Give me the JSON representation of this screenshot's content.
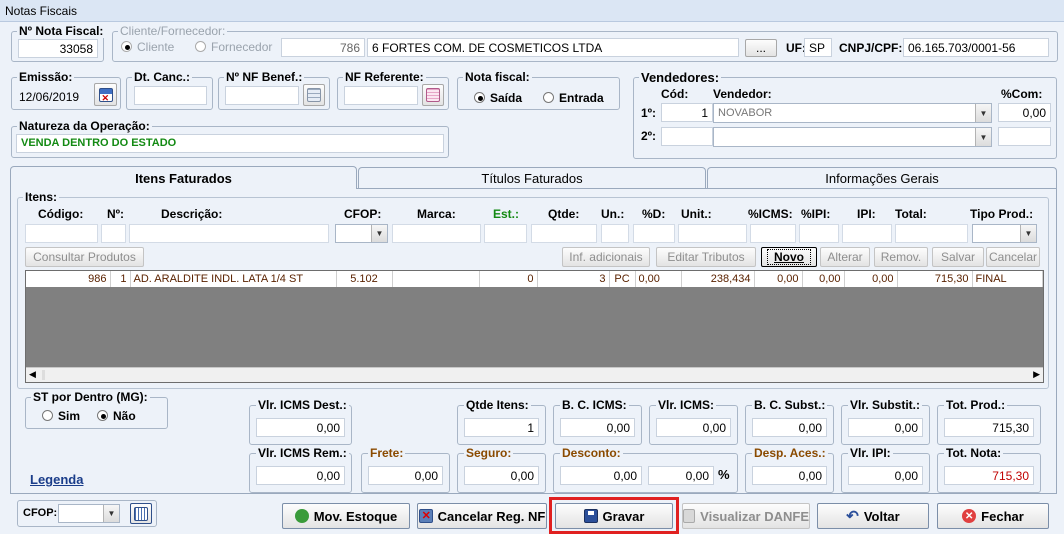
{
  "window": {
    "title": "Notas Fiscais"
  },
  "header": {
    "nota_fiscal_label": "Nº Nota Fiscal:",
    "nota_fiscal_value": "33058",
    "cliente_group_label": "Cliente/Fornecedor:",
    "cliente_radio": "Cliente",
    "fornecedor_radio": "Fornecedor",
    "cliente_code": "786",
    "cliente_name": "6 FORTES COM. DE COSMETICOS LTDA",
    "browse_button": "...",
    "uf_label": "UF:",
    "uf_value": "SP",
    "cnpj_label": "CNPJ/CPF:",
    "cnpj_value": "06.165.703/0001-56",
    "emissao_label": "Emissão:",
    "emissao_value": "12/06/2019",
    "dt_canc_label": "Dt. Canc.:",
    "dt_canc_value": "",
    "nf_benef_label": "Nº NF Benef.:",
    "nf_benef_value": "",
    "nf_referente_label": "NF Referente:",
    "nf_referente_value": "",
    "nota_fiscal_type_label": "Nota fiscal:",
    "saida_radio": "Saída",
    "entrada_radio": "Entrada",
    "natureza_label": "Natureza da Operação:",
    "natureza_value": "VENDA DENTRO DO ESTADO"
  },
  "vendedores": {
    "group_label": "Vendedores:",
    "cod_header": "Cód:",
    "vendedor_header": "Vendedor:",
    "com_header": "%Com:",
    "row1_label": "1º:",
    "row1_cod": "1",
    "row1_name": "NOVABOR",
    "row1_com": "0,00",
    "row2_label": "2º:",
    "row2_cod": "",
    "row2_name": "",
    "row2_com": ""
  },
  "tabs": [
    {
      "label": "Itens Faturados"
    },
    {
      "label": "Títulos Faturados"
    },
    {
      "label": "Informações Gerais"
    }
  ],
  "items": {
    "group_label": "Itens:",
    "headers": {
      "codigo": "Código:",
      "n": "Nº:",
      "descricao": "Descrição:",
      "cfop": "CFOP:",
      "marca": "Marca:",
      "est": "Est.:",
      "qtde": "Qtde:",
      "un": "Un.:",
      "pd": "%D:",
      "unit": "Unit.:",
      "icms": "%ICMS:",
      "ipi_pct": "%IPI:",
      "ipi": "IPI:",
      "total": "Total:",
      "tipo": "Tipo Prod.:"
    },
    "buttons": {
      "consultar": "Consultar Produtos",
      "inf_adicionais": "Inf. adicionais",
      "editar_tributos": "Editar Tributos",
      "novo": "Novo",
      "alterar": "Alterar",
      "remover": "Remov.",
      "salvar": "Salvar",
      "cancelar": "Cancelar"
    },
    "rows": [
      {
        "codigo": "986",
        "n": "1",
        "descricao": "AD. ARALDITE INDL. LATA 1/4 ST",
        "cfop": "5.102",
        "marca": "",
        "est": "0",
        "qtde": "3",
        "un": "PC",
        "pd": "0,00",
        "unit": "238,434",
        "icms": "0,00",
        "ipi_pct": "0,00",
        "ipi": "0,00",
        "total": "715,30",
        "tipo": "FINAL"
      }
    ]
  },
  "st": {
    "group_label": "ST por Dentro (MG):",
    "sim": "Sim",
    "nao": "Não"
  },
  "totals": {
    "vlr_icms_dest_label": "Vlr. ICMS Dest.:",
    "vlr_icms_dest": "0,00",
    "qtde_itens_label": "Qtde Itens:",
    "qtde_itens": "1",
    "bc_icms_label": "B. C. ICMS:",
    "bc_icms": "0,00",
    "vlr_icms_label": "Vlr. ICMS:",
    "vlr_icms": "0,00",
    "bc_subst_label": "B. C. Subst.:",
    "bc_subst": "0,00",
    "vlr_subst_label": "Vlr. Substit.:",
    "vlr_subst": "0,00",
    "tot_prod_label": "Tot. Prod.:",
    "tot_prod": "715,30",
    "vlr_icms_rem_label": "Vlr. ICMS Rem.:",
    "vlr_icms_rem": "0,00",
    "frete_label": "Frete:",
    "frete": "0,00",
    "seguro_label": "Seguro:",
    "seguro": "0,00",
    "desconto_label": "Desconto:",
    "desconto": "0,00",
    "desconto_pct": "0,00",
    "pct_sign": "%",
    "desp_aces_label": "Desp. Aces.:",
    "desp_aces": "0,00",
    "vlr_ipi_label": "Vlr. IPI:",
    "vlr_ipi": "0,00",
    "tot_nota_label": "Tot. Nota:",
    "tot_nota": "715,30"
  },
  "legenda": "Legenda",
  "footer": {
    "cfop_label": "CFOP:",
    "mov_estoque": "Mov. Estoque",
    "cancelar_reg": "Cancelar Reg. NF",
    "gravar": "Gravar",
    "visualizar_danfe": "Visualizar DANFE",
    "voltar": "Voltar",
    "fechar": "Fechar"
  },
  "colors": {
    "accent_red": "#e02020",
    "green_text": "#138a13",
    "row_text": "#5a2200",
    "total_red": "#c00000"
  }
}
